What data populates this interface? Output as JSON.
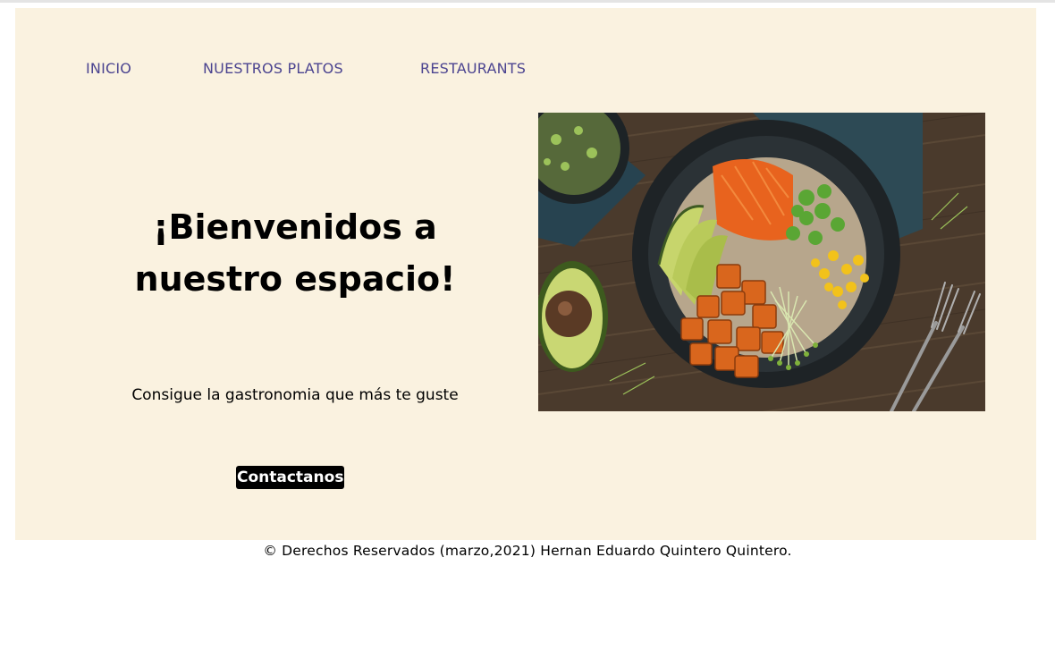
{
  "nav": {
    "items": [
      {
        "label": "INICIO"
      },
      {
        "label": "NUESTROS PLATOS"
      },
      {
        "label": "RESTAURANTS"
      }
    ]
  },
  "hero": {
    "title": "¡Bienvenidos a nuestro espacio!",
    "subtitle": "Consigue la gastronomia que más te guste",
    "cta_label": "Contactanos",
    "image_icon": "food-bowl-photo"
  },
  "footer": {
    "text": "© Derechos Reservados (marzo,2021) Hernan Eduardo Quintero Quintero."
  },
  "colors": {
    "panel_bg": "#faf2e0",
    "nav_link": "#4b4490",
    "button_bg": "#000000",
    "button_text": "#ffffff"
  }
}
